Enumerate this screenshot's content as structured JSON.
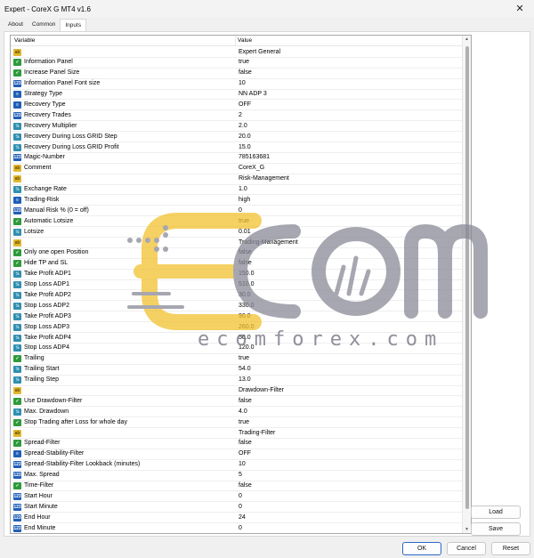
{
  "window": {
    "title": "Expert - CoreX G MT4 v1.6",
    "close_glyph": "✕"
  },
  "tabs": [
    {
      "label": "About",
      "active": false
    },
    {
      "label": "Common",
      "active": false
    },
    {
      "label": "Inputs",
      "active": true
    }
  ],
  "grid": {
    "columns": {
      "variable": "Variable",
      "value": "Value"
    },
    "rows": [
      {
        "type": "ab",
        "name": "",
        "value": "Expert General"
      },
      {
        "type": "bool",
        "name": "Information Panel",
        "value": "true"
      },
      {
        "type": "bool",
        "name": "Increase Panel Size",
        "value": "false"
      },
      {
        "type": "int",
        "name": "Information Panel Font size",
        "value": "10"
      },
      {
        "type": "en",
        "name": "Strategy Type",
        "value": "NN ADP 3"
      },
      {
        "type": "en",
        "name": "Recovery Type",
        "value": "OFF"
      },
      {
        "type": "int",
        "name": "Recovery Trades",
        "value": "2"
      },
      {
        "type": "dbl",
        "name": "Recovery Multiplier",
        "value": "2.0"
      },
      {
        "type": "dbl",
        "name": "Recovery During Loss GRID Step",
        "value": "20.0"
      },
      {
        "type": "dbl",
        "name": "Recovery During Loss GRID Profit",
        "value": "15.0"
      },
      {
        "type": "int",
        "name": "Magic-Number",
        "value": "785163681"
      },
      {
        "type": "ab",
        "name": "Comment",
        "value": "CoreX_G"
      },
      {
        "type": "ab",
        "name": "",
        "value": "Risk-Management"
      },
      {
        "type": "dbl",
        "name": "Exchange Rate",
        "value": "1.0"
      },
      {
        "type": "en",
        "name": "Trading-Risk",
        "value": "high"
      },
      {
        "type": "int",
        "name": "Manual Risk % (0 = off)",
        "value": "0"
      },
      {
        "type": "bool",
        "name": "Automatic Lotsize",
        "value": "true"
      },
      {
        "type": "dbl",
        "name": "Lotsize",
        "value": "0.01"
      },
      {
        "type": "ab",
        "name": "",
        "value": "Trading-Management"
      },
      {
        "type": "bool",
        "name": "Only one open Position",
        "value": "false"
      },
      {
        "type": "bool",
        "name": "Hide TP and SL",
        "value": "false"
      },
      {
        "type": "dbl",
        "name": "Take Profit ADP1",
        "value": "150.0"
      },
      {
        "type": "dbl",
        "name": "Stop Loss ADP1",
        "value": "510.0"
      },
      {
        "type": "dbl",
        "name": "Take Profit ADP2",
        "value": "30.0"
      },
      {
        "type": "dbl",
        "name": "Stop Loss ADP2",
        "value": "330.0"
      },
      {
        "type": "dbl",
        "name": "Take Profit ADP3",
        "value": "90.0"
      },
      {
        "type": "dbl",
        "name": "Stop Loss ADP3",
        "value": "260.0"
      },
      {
        "type": "dbl",
        "name": "Take Profit ADP4",
        "value": "50.0"
      },
      {
        "type": "dbl",
        "name": "Stop Loss ADP4",
        "value": "120.0"
      },
      {
        "type": "bool",
        "name": "Trailing",
        "value": "true"
      },
      {
        "type": "dbl",
        "name": "Trailing Start",
        "value": "54.0"
      },
      {
        "type": "dbl",
        "name": "Trailing Step",
        "value": "13.0"
      },
      {
        "type": "ab",
        "name": "",
        "value": "Drawdown-Filter"
      },
      {
        "type": "bool",
        "name": "Use Drawdown-Filter",
        "value": "false"
      },
      {
        "type": "dbl",
        "name": "Max. Drawdown",
        "value": "4.0"
      },
      {
        "type": "bool",
        "name": "Stop Trading after Loss for whole day",
        "value": "true"
      },
      {
        "type": "ab",
        "name": "",
        "value": "Trading-Filter"
      },
      {
        "type": "bool",
        "name": "Spread-Filter",
        "value": "false"
      },
      {
        "type": "en",
        "name": "Spread-Stability-Filter",
        "value": "OFF"
      },
      {
        "type": "int",
        "name": "Spread-Stability-Filter Lookback (minutes)",
        "value": "10"
      },
      {
        "type": "int",
        "name": "Max. Spread",
        "value": "5"
      },
      {
        "type": "bool",
        "name": "Time-Filter",
        "value": "false"
      },
      {
        "type": "int",
        "name": "Start Hour",
        "value": "0"
      },
      {
        "type": "int",
        "name": "Start Minute",
        "value": "0"
      },
      {
        "type": "int",
        "name": "End Hour",
        "value": "24"
      },
      {
        "type": "int",
        "name": "End Minute",
        "value": "0"
      }
    ]
  },
  "side_buttons": {
    "load": "Load",
    "save": "Save"
  },
  "footer_buttons": {
    "ok": "OK",
    "cancel": "Cancel",
    "reset": "Reset"
  },
  "watermark": {
    "url_text": "ecomforex.com",
    "colors": {
      "yellow": "#f2c230",
      "gray": "#8a8a98"
    }
  },
  "colors": {
    "accent": "#2b68c6"
  }
}
